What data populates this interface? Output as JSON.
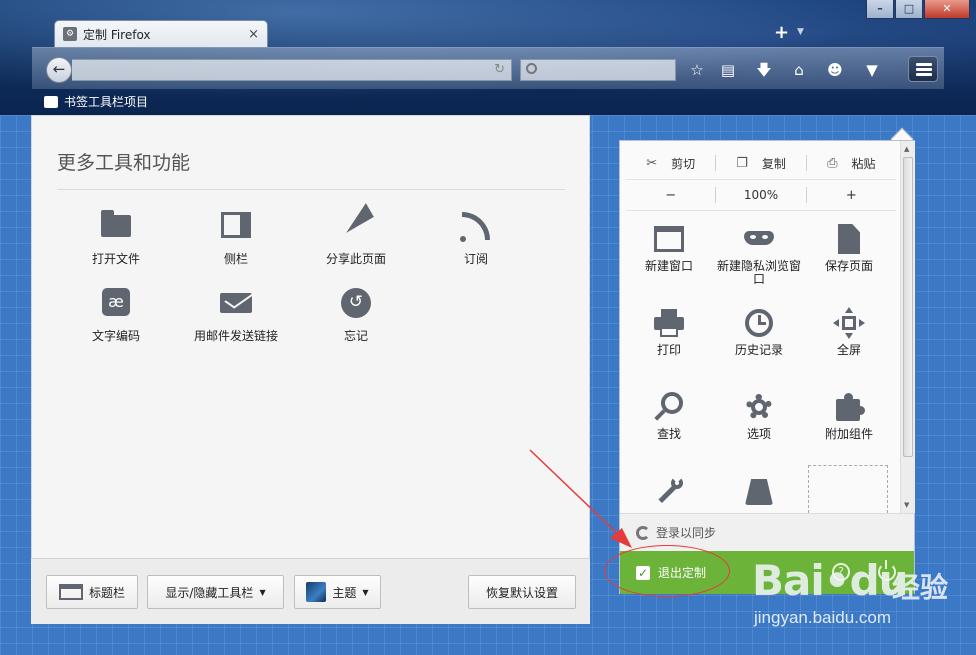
{
  "window": {
    "minimize_label": "–",
    "maximize_label": "□",
    "close_label": "✕"
  },
  "tab": {
    "title": "定制 Firefox",
    "close": "×",
    "new_tab": "+"
  },
  "bookmarks_bar": {
    "label": "书签工具栏项目"
  },
  "palette": {
    "title": "更多工具和功能",
    "items": [
      {
        "label": "打开文件",
        "icon": "folder-icon"
      },
      {
        "label": "侧栏",
        "icon": "sidebar-icon"
      },
      {
        "label": "分享此页面",
        "icon": "share-icon"
      },
      {
        "label": "订阅",
        "icon": "rss-icon"
      },
      {
        "label": "文字编码",
        "icon": "encoding-icon",
        "glyph": "æ"
      },
      {
        "label": "用邮件发送链接",
        "icon": "email-icon"
      },
      {
        "label": "忘记",
        "icon": "forget-icon"
      }
    ]
  },
  "footer": {
    "titlebar": "标题栏",
    "toolbars": "显示/隐藏工具栏",
    "theme": "主题",
    "restore": "恢复默认设置"
  },
  "menu_panel": {
    "cut": "剪切",
    "copy": "复制",
    "paste": "粘贴",
    "zoom_out": "−",
    "zoom": "100%",
    "zoom_in": "+",
    "items": [
      {
        "label": "新建窗口",
        "icon": "new-window-icon"
      },
      {
        "label": "新建隐私浏览窗口",
        "icon": "private-mask-icon"
      },
      {
        "label": "保存页面",
        "icon": "save-page-icon"
      },
      {
        "label": "打印",
        "icon": "print-icon"
      },
      {
        "label": "历史记录",
        "icon": "history-clock-icon"
      },
      {
        "label": "全屏",
        "icon": "fullscreen-icon"
      },
      {
        "label": "查找",
        "icon": "find-icon"
      },
      {
        "label": "选项",
        "icon": "options-gear-icon"
      },
      {
        "label": "附加组件",
        "icon": "addons-puzzle-icon"
      }
    ],
    "sync": "登录以同步",
    "exit_customize": "退出定制",
    "help": "?"
  },
  "watermark": {
    "logo": "Bai•du",
    "text": "经验",
    "url": "jingyan.baidu.com"
  },
  "colors": {
    "exit_green": "#6cb33a",
    "annotation_red": "#e53b3b",
    "blueprint_blue": "#3b78c6"
  }
}
